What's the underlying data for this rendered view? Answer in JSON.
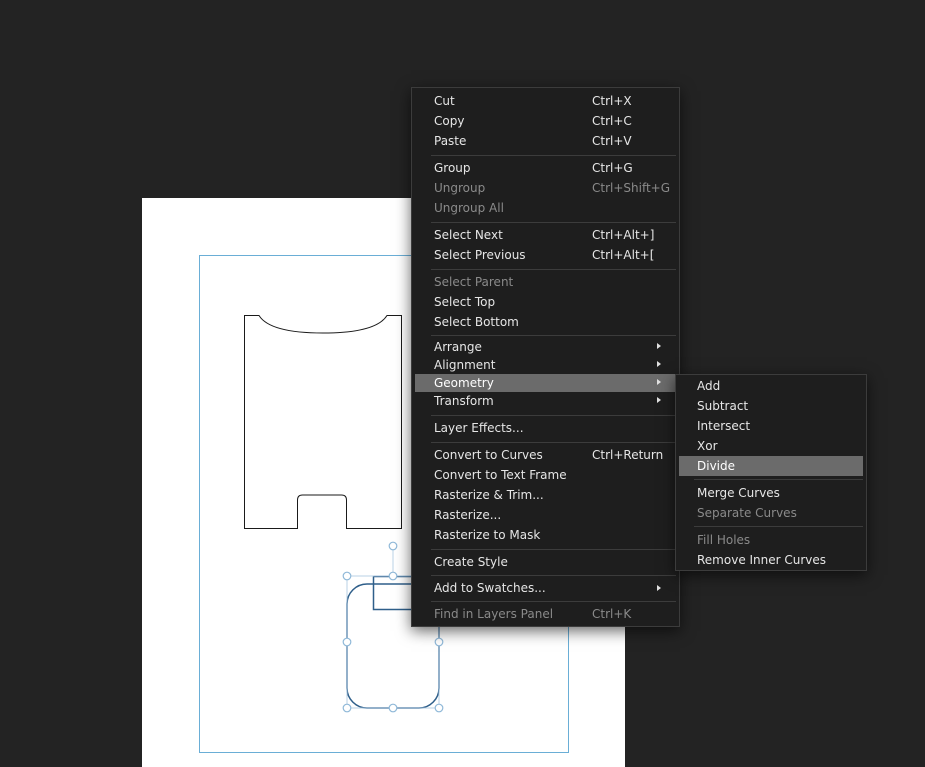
{
  "context_menu": {
    "items": [
      {
        "label": "Cut",
        "shortcut": "Ctrl+X"
      },
      {
        "label": "Copy",
        "shortcut": "Ctrl+C"
      },
      {
        "label": "Paste",
        "shortcut": "Ctrl+V"
      },
      {
        "label": "Group",
        "shortcut": "Ctrl+G"
      },
      {
        "label": "Ungroup",
        "shortcut": "Ctrl+Shift+G",
        "disabled": true
      },
      {
        "label": "Ungroup All",
        "disabled": true
      },
      {
        "label": "Select Next",
        "shortcut": "Ctrl+Alt+]"
      },
      {
        "label": "Select Previous",
        "shortcut": "Ctrl+Alt+["
      },
      {
        "label": "Select Parent",
        "disabled": true
      },
      {
        "label": "Select Top"
      },
      {
        "label": "Select Bottom"
      },
      {
        "label": "Arrange",
        "submenu": true
      },
      {
        "label": "Alignment",
        "submenu": true
      },
      {
        "label": "Geometry",
        "submenu": true,
        "highlighted": true
      },
      {
        "label": "Transform",
        "submenu": true
      },
      {
        "label": "Layer Effects..."
      },
      {
        "label": "Convert to Curves",
        "shortcut": "Ctrl+Return"
      },
      {
        "label": "Convert to Text Frame"
      },
      {
        "label": "Rasterize & Trim..."
      },
      {
        "label": "Rasterize..."
      },
      {
        "label": "Rasterize to Mask"
      },
      {
        "label": "Create Style"
      },
      {
        "label": "Add to Swatches...",
        "submenu": true
      },
      {
        "label": "Find in Layers Panel",
        "shortcut": "Ctrl+K",
        "disabled": true
      }
    ]
  },
  "geometry_submenu": {
    "items": [
      {
        "label": "Add"
      },
      {
        "label": "Subtract"
      },
      {
        "label": "Intersect"
      },
      {
        "label": "Xor"
      },
      {
        "label": "Divide",
        "highlighted": true
      },
      {
        "label": "Merge Curves"
      },
      {
        "label": "Separate Curves",
        "disabled": true
      },
      {
        "label": "Fill Holes",
        "disabled": true
      },
      {
        "label": "Remove Inner Curves"
      }
    ]
  },
  "colors": {
    "workspace_bg": "#232323",
    "page_bg": "#ffffff",
    "guide_border": "#6aaed6",
    "selection_handle": "#8fb8d8",
    "selected_shape_stroke": "#2f5f8a",
    "menu_bg": "#1e1e1e",
    "menu_highlight": "#6b6b6b"
  }
}
